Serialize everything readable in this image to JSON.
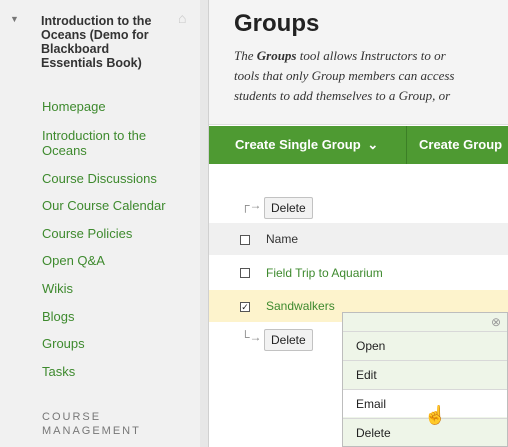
{
  "sidebar": {
    "course_title": "Introduction to the Oceans (Demo for Blackboard Essentials Book)",
    "course_title_lines": [
      "Introduction to the",
      "Oceans (Demo for",
      "Blackboard",
      "Essentials Book)"
    ],
    "home_icon": "home-icon",
    "links": [
      {
        "label": "Homepage"
      },
      {
        "label": "Introduction to the Oceans"
      },
      {
        "label": "Course Discussions"
      },
      {
        "label": "Our Course Calendar"
      },
      {
        "label": "Course Policies"
      },
      {
        "label": "Open Q&A"
      },
      {
        "label": "Wikis"
      },
      {
        "label": "Blogs"
      },
      {
        "label": "Groups"
      },
      {
        "label": "Tasks"
      }
    ],
    "section_title": "COURSE MANAGEMENT",
    "section_lines": [
      "COURSE",
      "MANAGEMENT"
    ]
  },
  "page": {
    "title": "Groups",
    "description_line1_pre": "The ",
    "description_bold": "Groups",
    "description_line1_post": " tool allows Instructors to or",
    "description_line2": "tools that only Group members can access",
    "description_line3": "students to add themselves to a Group, or"
  },
  "toolbar": {
    "create_single_group": "Create Single Group",
    "chevron": "⌄",
    "create_group_set": "Create Group"
  },
  "table": {
    "delete_top": "Delete",
    "column_name": "Name",
    "rows": [
      {
        "name": "Field Trip to Aquarium",
        "checked": false
      },
      {
        "name": "Sandwalkers",
        "checked": true
      }
    ],
    "delete_bottom": "Delete"
  },
  "context_menu": {
    "items": [
      "Open",
      "Edit",
      "Email",
      "Delete"
    ],
    "highlighted": "Email"
  },
  "colors": {
    "accent_green": "#4e9a32",
    "link_green": "#3e8a2e",
    "selected_row": "#fdf3cc"
  }
}
